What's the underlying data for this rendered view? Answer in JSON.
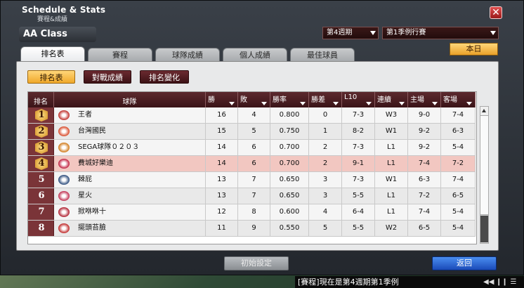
{
  "window": {
    "title_en": "Schedule & Stats",
    "title_zh": "賽程&成績",
    "close_label": "✕"
  },
  "class_label": "AA Class",
  "selects": [
    {
      "value": "第4週期"
    },
    {
      "value": "第1季例行賽"
    }
  ],
  "today_button": "本日",
  "tabs": [
    "排名表",
    "賽程",
    "球隊成績",
    "個人成績",
    "最佳球員"
  ],
  "sub_tabs": [
    "排名表",
    "對戰成績",
    "排名變化"
  ],
  "table": {
    "headers": [
      "排名",
      "球隊",
      "勝",
      "敗",
      "勝率",
      "勝差",
      "L10",
      "連續",
      "主場",
      "客場"
    ],
    "rows": [
      {
        "rank": "1",
        "team": "王者",
        "w": "16",
        "l": "4",
        "pct": "0.800",
        "gb": "0",
        "l10": "7-3",
        "streak": "W3",
        "home": "9-0",
        "away": "7-4",
        "icon_color": "#c0302a"
      },
      {
        "rank": "2",
        "team": "台灣國民",
        "w": "15",
        "l": "5",
        "pct": "0.750",
        "gb": "1",
        "l10": "8-2",
        "streak": "W1",
        "home": "9-2",
        "away": "6-3",
        "icon_color": "#d84a2a"
      },
      {
        "rank": "3",
        "team": "SEGA球隊０２０３",
        "w": "14",
        "l": "6",
        "pct": "0.700",
        "gb": "2",
        "l10": "7-3",
        "streak": "L1",
        "home": "9-2",
        "away": "5-4",
        "icon_color": "#d07a1a"
      },
      {
        "rank": "4",
        "team": "費城好樂迪",
        "w": "14",
        "l": "6",
        "pct": "0.700",
        "gb": "2",
        "l10": "9-1",
        "streak": "L1",
        "home": "7-4",
        "away": "7-2",
        "icon_color": "#c02040"
      },
      {
        "rank": "5",
        "team": "棘屁",
        "w": "13",
        "l": "7",
        "pct": "0.650",
        "gb": "3",
        "l10": "7-3",
        "streak": "W1",
        "home": "6-3",
        "away": "7-4",
        "icon_color": "#2a4a7a"
      },
      {
        "rank": "6",
        "team": "星火",
        "w": "13",
        "l": "7",
        "pct": "0.650",
        "gb": "3",
        "l10": "5-5",
        "streak": "L1",
        "home": "7-2",
        "away": "6-5",
        "icon_color": "#c03050"
      },
      {
        "rank": "7",
        "team": "掀咻咻十",
        "w": "12",
        "l": "8",
        "pct": "0.600",
        "gb": "4",
        "l10": "6-4",
        "streak": "L1",
        "home": "7-4",
        "away": "5-4",
        "icon_color": "#b02030"
      },
      {
        "rank": "8",
        "team": "擺頭苔臉",
        "w": "11",
        "l": "9",
        "pct": "0.550",
        "gb": "5",
        "l10": "5-5",
        "streak": "W2",
        "home": "6-5",
        "away": "5-4",
        "icon_color": "#c02a2a"
      }
    ]
  },
  "buttons": {
    "init": "初始設定",
    "back": "返回"
  },
  "ticker": {
    "text": "[賽程]現在是第4週期第1季例"
  },
  "colors": {
    "accent": "#f0a82a",
    "header": "#4a1e22",
    "highlight_row": "#f2c7c1"
  }
}
